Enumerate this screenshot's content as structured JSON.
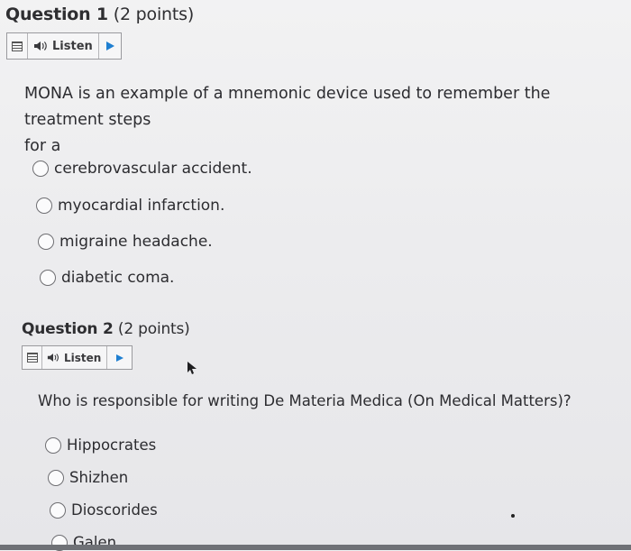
{
  "questions": [
    {
      "number": "Question 1",
      "points": "(2 points)",
      "listen_label": "Listen",
      "prompt_line1": "MONA is an example of a mnemonic device used to remember the treatment steps",
      "prompt_line2": "for a",
      "options": [
        "cerebrovascular accident.",
        "myocardial infarction.",
        "migraine headache.",
        "diabetic coma."
      ]
    },
    {
      "number": "Question 2",
      "points": "(2 points)",
      "listen_label": "Listen",
      "prompt": "Who is responsible for writing De Materia Medica (On Medical Matters)?",
      "options": [
        "Hippocrates",
        "Shizhen",
        "Dioscorides",
        "Galen"
      ]
    }
  ],
  "icons": {
    "menu": "menu-icon",
    "speaker": "speaker-icon",
    "play": "play-icon"
  },
  "colors": {
    "play_accent": "#1f7fd1"
  }
}
